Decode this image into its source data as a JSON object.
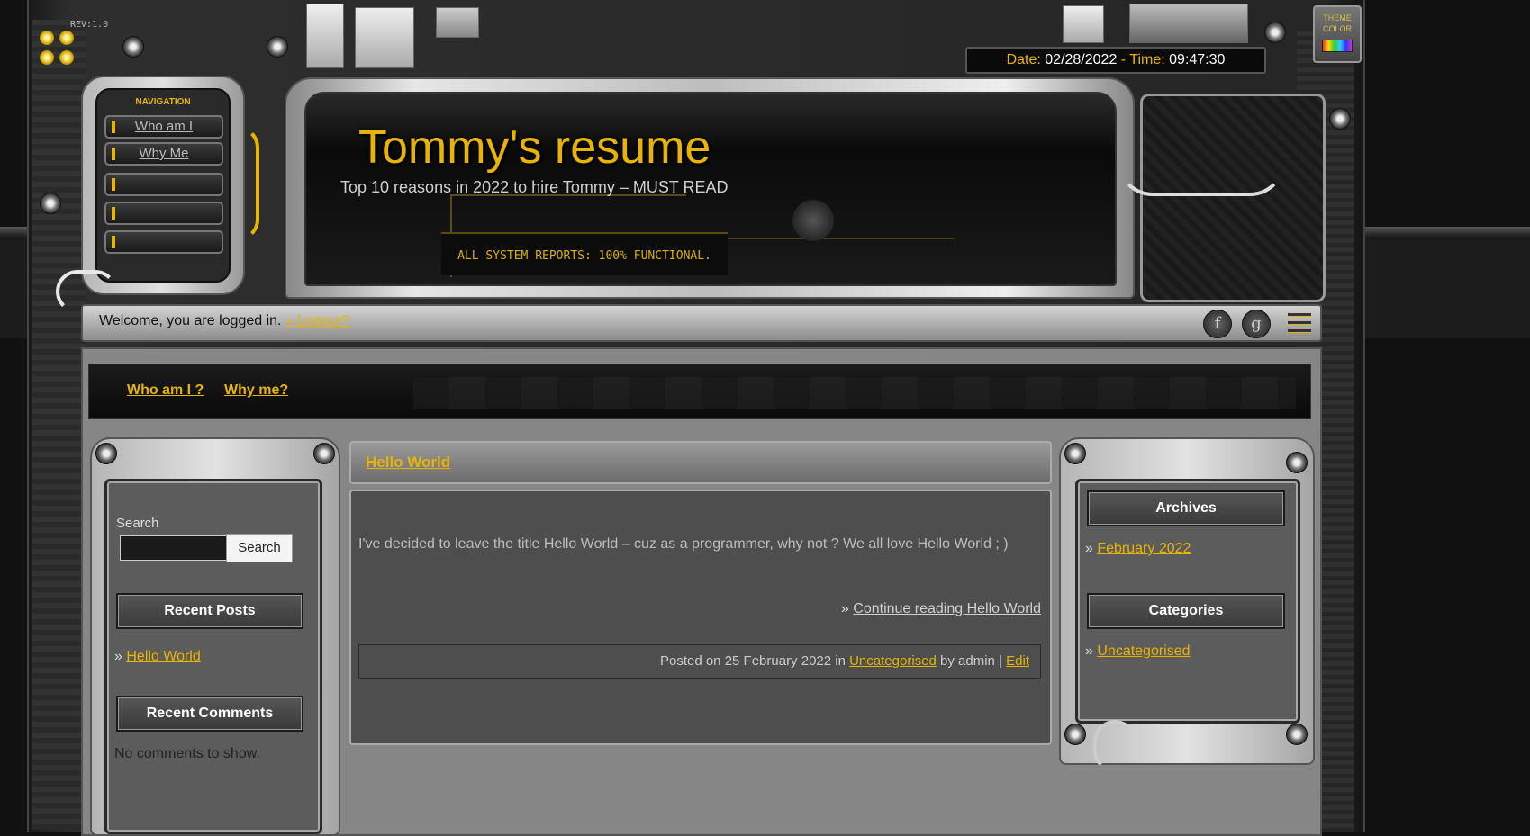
{
  "header": {
    "rev": "REV:1.0",
    "date_label": "Date:",
    "date_value": "02/28/2022",
    "time_label": "Time:",
    "time_value": "09:47:30",
    "theme_label_1": "THEME",
    "theme_label_2": "COLOR",
    "site_title": "Tommy's resume",
    "site_description": "Top 10 reasons in 2022 to hire Tommy – MUST READ",
    "system_status": "ALL SYSTEM REPORTS: 100% FUNCTIONAL."
  },
  "nav": {
    "title": "NAVIGATION",
    "items": [
      {
        "label": "Who am I"
      },
      {
        "label": "Why Me"
      },
      {
        "label": ""
      },
      {
        "label": ""
      },
      {
        "label": ""
      }
    ]
  },
  "userbar": {
    "welcome": "Welcome, you are logged in.",
    "logout": "» Logout?",
    "social": {
      "facebook": "f",
      "google": "g"
    }
  },
  "menu": {
    "items": [
      {
        "label": "Who am I ?"
      },
      {
        "label": "Why me?"
      }
    ]
  },
  "sidebar_left": {
    "search_label": "Search",
    "search_value": "",
    "search_button": "Search",
    "recent_posts_title": "Recent Posts",
    "recent_posts": [
      {
        "bullet": "»",
        "label": "Hello World"
      }
    ],
    "recent_comments_title": "Recent Comments",
    "recent_comments_empty": "No comments to show."
  },
  "post": {
    "title": "Hello World",
    "excerpt": "I've decided to leave the title Hello World – cuz as a programmer, why not ? We all love Hello World ; )",
    "continue_bullet": "»",
    "continue_label": "Continue reading Hello World",
    "meta_prefix": "Posted on 25 February 2022 in",
    "category": "Uncategorised",
    "meta_by": "by admin |",
    "edit": "Edit"
  },
  "sidebar_right": {
    "archives_title": "Archives",
    "archives": [
      {
        "bullet": "»",
        "label": "February 2022"
      }
    ],
    "categories_title": "Categories",
    "categories": [
      {
        "bullet": "»",
        "label": "Uncategorised"
      }
    ]
  },
  "colors": {
    "accent": "#e8b400",
    "panel": "#868686",
    "dark": "#111111"
  }
}
